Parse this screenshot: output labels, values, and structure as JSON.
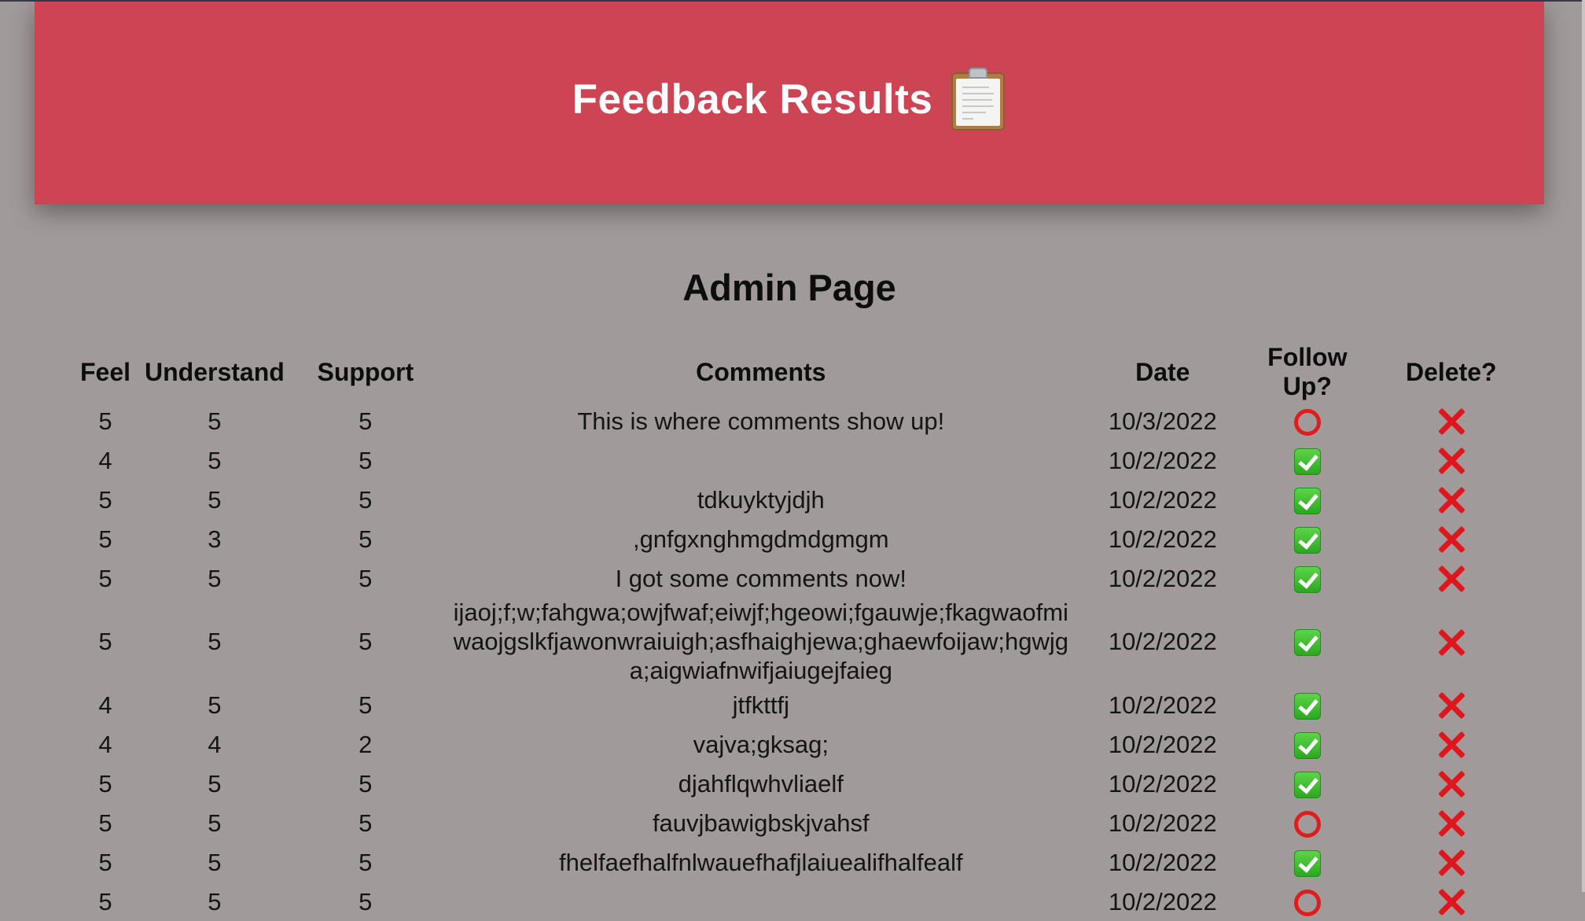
{
  "header": {
    "title": "Feedback Results",
    "title_icon": "clipboard-icon",
    "background": "#cd4455"
  },
  "page": {
    "heading": "Admin Page",
    "background": "#a19a9a"
  },
  "table": {
    "columns": [
      "Feel",
      "Understand",
      "Support",
      "Comments",
      "Date",
      "Follow Up?",
      "Delete?"
    ],
    "rows": [
      {
        "feel": "5",
        "understand": "5",
        "support": "5",
        "comment": "This is where comments show up!",
        "date": "10/3/2022",
        "follow_up": "circle-icon",
        "delete": "x-icon"
      },
      {
        "feel": "4",
        "understand": "5",
        "support": "5",
        "comment": "",
        "date": "10/2/2022",
        "follow_up": "check-icon",
        "delete": "x-icon"
      },
      {
        "feel": "5",
        "understand": "5",
        "support": "5",
        "comment": "tdkuyktyjdjh",
        "date": "10/2/2022",
        "follow_up": "check-icon",
        "delete": "x-icon"
      },
      {
        "feel": "5",
        "understand": "3",
        "support": "5",
        "comment": ",gnfgxnghmgdmdgmgm",
        "date": "10/2/2022",
        "follow_up": "check-icon",
        "delete": "x-icon"
      },
      {
        "feel": "5",
        "understand": "5",
        "support": "5",
        "comment": "I got some comments now!",
        "date": "10/2/2022",
        "follow_up": "check-icon",
        "delete": "x-icon"
      },
      {
        "feel": "5",
        "understand": "5",
        "support": "5",
        "comment": "ijaoj;f;w;fahgwa;owjfwaf;eiwjf;hgeowi;fgauwje;fkagwaofmiwaojgslkfjawonwraiuigh;asfhaighjewa;ghaewfoijaw;hgwjga;aigwiafnwifjaiugejfaieg",
        "date": "10/2/2022",
        "follow_up": "check-icon",
        "delete": "x-icon"
      },
      {
        "feel": "4",
        "understand": "5",
        "support": "5",
        "comment": "jtfkttfj",
        "date": "10/2/2022",
        "follow_up": "check-icon",
        "delete": "x-icon"
      },
      {
        "feel": "4",
        "understand": "4",
        "support": "2",
        "comment": "vajva;gksag;",
        "date": "10/2/2022",
        "follow_up": "check-icon",
        "delete": "x-icon"
      },
      {
        "feel": "5",
        "understand": "5",
        "support": "5",
        "comment": "djahflqwhvliaelf",
        "date": "10/2/2022",
        "follow_up": "check-icon",
        "delete": "x-icon"
      },
      {
        "feel": "5",
        "understand": "5",
        "support": "5",
        "comment": "fauvjbawigbskjvahsf",
        "date": "10/2/2022",
        "follow_up": "circle-icon",
        "delete": "x-icon"
      },
      {
        "feel": "5",
        "understand": "5",
        "support": "5",
        "comment": "fhelfaefhalfnlwauefhafjlaiuealifhalfealf",
        "date": "10/2/2022",
        "follow_up": "check-icon",
        "delete": "x-icon"
      },
      {
        "feel": "5",
        "understand": "5",
        "support": "5",
        "comment": "",
        "date": "10/2/2022",
        "follow_up": "circle-icon",
        "delete": "x-icon"
      }
    ]
  }
}
